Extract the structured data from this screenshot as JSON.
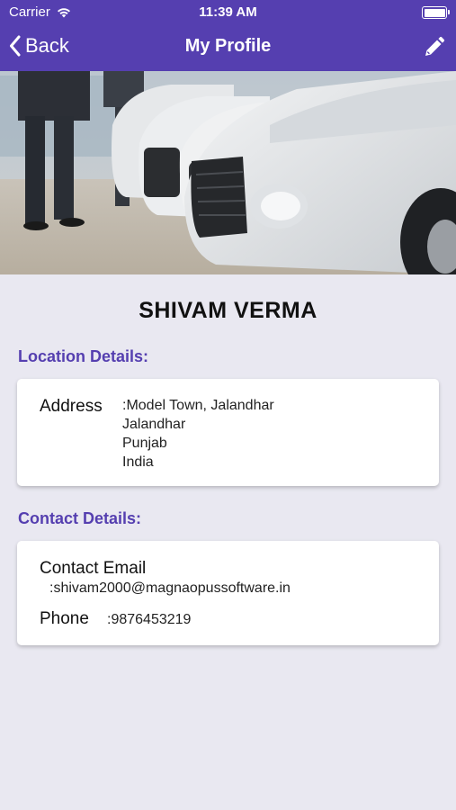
{
  "status_bar": {
    "carrier": "Carrier",
    "time": "11:39 AM"
  },
  "nav": {
    "back_label": "Back",
    "title": "My Profile"
  },
  "profile": {
    "name": "SHIVAM VERMA"
  },
  "location": {
    "heading": "Location Details:",
    "address_label": "Address",
    "address_lines": [
      ":Model Town, Jalandhar",
      "Jalandhar",
      "Punjab",
      "India"
    ]
  },
  "contact": {
    "heading": "Contact Details:",
    "email_label": "Contact Email",
    "email_value": ":shivam2000@magnaopussoftware.in",
    "phone_label": "Phone",
    "phone_value": ":9876453219"
  },
  "colors": {
    "accent": "#553fb0",
    "background": "#e9e8f1",
    "card": "#ffffff"
  },
  "icons": {
    "back": "chevron-left-icon",
    "edit": "pencil-icon",
    "wifi": "wifi-icon",
    "battery": "battery-icon"
  }
}
